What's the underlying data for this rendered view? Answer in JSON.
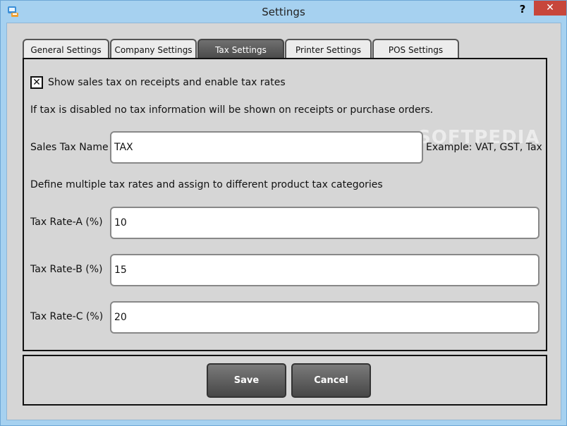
{
  "window": {
    "title": "Settings",
    "help_label": "?",
    "close_label": "✕"
  },
  "tabs": [
    {
      "label": "General Settings",
      "active": false
    },
    {
      "label": "Company Settings",
      "active": false
    },
    {
      "label": "Tax Settings",
      "active": true
    },
    {
      "label": "Printer Settings",
      "active": false
    },
    {
      "label": "POS Settings",
      "active": false
    }
  ],
  "tax": {
    "enable_checkbox_checked": true,
    "enable_checkbox_mark": "✕",
    "enable_label": "Show sales tax on receipts and enable tax rates",
    "disabled_note": "If tax is disabled no tax information will be shown on receipts or purchase orders.",
    "sales_tax_name_label": "Sales Tax Name",
    "sales_tax_name_value": "TAX",
    "sales_tax_name_hint": "Example: VAT, GST, Tax",
    "rates_note": "Define multiple tax rates and assign to different product tax categories",
    "rates": [
      {
        "label": "Tax Rate-A (%)",
        "value": "10"
      },
      {
        "label": "Tax Rate-B (%)",
        "value": "15"
      },
      {
        "label": "Tax Rate-C (%)",
        "value": "20"
      }
    ]
  },
  "footer": {
    "save_label": "Save",
    "cancel_label": "Cancel"
  },
  "watermark": "SOFTPEDIA"
}
